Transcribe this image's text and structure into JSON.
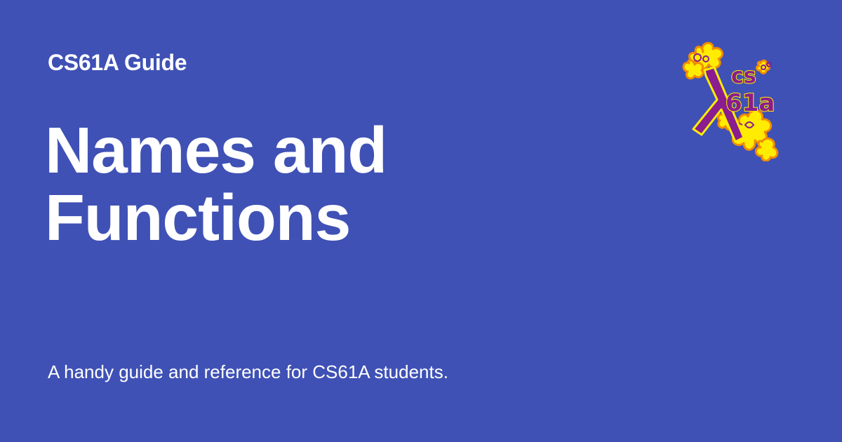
{
  "card": {
    "eyebrow": "CS61A Guide",
    "title_lines": [
      "Names and",
      "Functions"
    ],
    "subtitle": "A handy guide and reference for CS61A students.",
    "logo": {
      "icon": "cs61a-lambda-logo",
      "text": "cs 61a",
      "colors": {
        "flower_fill": "#ffec00",
        "flower_outline": "#f28c00",
        "lambda": "#8a1d8f"
      }
    }
  },
  "colors": {
    "background": "#3f51b5",
    "text": "#ffffff"
  }
}
